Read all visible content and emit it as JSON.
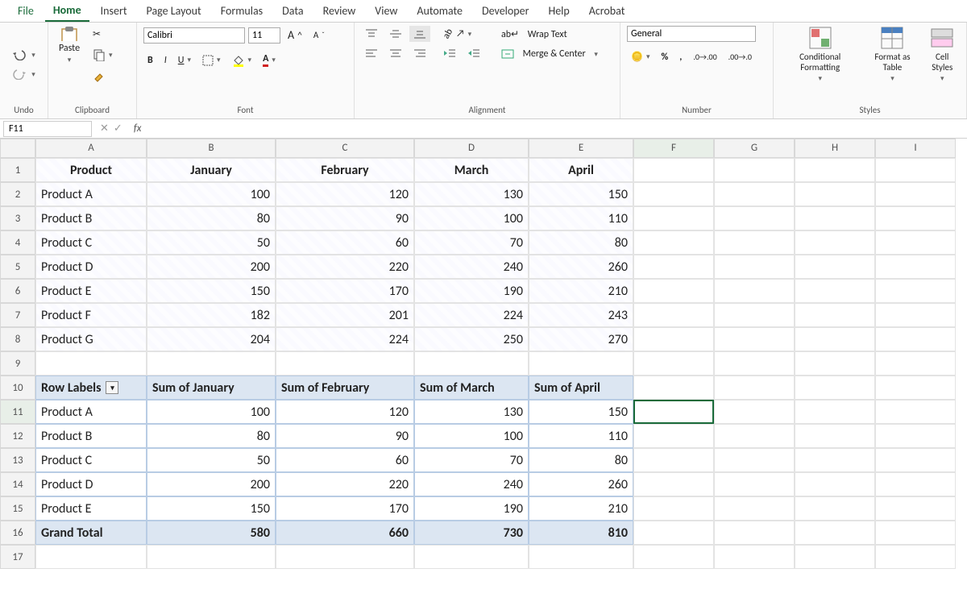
{
  "menu": {
    "items": [
      "File",
      "Home",
      "Insert",
      "Page Layout",
      "Formulas",
      "Data",
      "Review",
      "View",
      "Automate",
      "Developer",
      "Help",
      "Acrobat"
    ],
    "active": "Home"
  },
  "ribbon": {
    "groups": [
      "Undo",
      "Clipboard",
      "Font",
      "Alignment",
      "Number",
      "Styles"
    ],
    "clipboard": {
      "paste": "Paste"
    },
    "font": {
      "name": "Calibri",
      "size": "11"
    },
    "alignment": {
      "wrap": "Wrap Text",
      "merge": "Merge & Center"
    },
    "number": {
      "format": "General"
    },
    "styles": {
      "cond": "Conditional Formatting",
      "fat": "Format as Table",
      "cell": "Cell Styles"
    }
  },
  "namebox": "F11",
  "columns": [
    "A",
    "B",
    "C",
    "D",
    "E",
    "F",
    "G",
    "H",
    "I"
  ],
  "table": {
    "headers": [
      "Product",
      "January",
      "February",
      "March",
      "April"
    ],
    "rows": [
      [
        "Product A",
        100,
        120,
        130,
        150
      ],
      [
        "Product B",
        80,
        90,
        100,
        110
      ],
      [
        "Product C",
        50,
        60,
        70,
        80
      ],
      [
        "Product D",
        200,
        220,
        240,
        260
      ],
      [
        "Product E",
        150,
        170,
        190,
        210
      ],
      [
        "Product F",
        182,
        201,
        224,
        243
      ],
      [
        "Product G",
        204,
        224,
        250,
        270
      ]
    ]
  },
  "pivot": {
    "headers": [
      "Row Labels",
      "Sum of January",
      "Sum of February",
      "Sum of March",
      "Sum of April"
    ],
    "rows": [
      [
        "Product A",
        100,
        120,
        130,
        150
      ],
      [
        "Product B",
        80,
        90,
        100,
        110
      ],
      [
        "Product C",
        50,
        60,
        70,
        80
      ],
      [
        "Product D",
        200,
        220,
        240,
        260
      ],
      [
        "Product E",
        150,
        170,
        190,
        210
      ]
    ],
    "grand": [
      "Grand Total",
      580,
      660,
      730,
      810
    ]
  },
  "rownums": [
    1,
    2,
    3,
    4,
    5,
    6,
    7,
    8,
    9,
    10,
    11,
    12,
    13,
    14,
    15,
    16,
    17
  ],
  "selected": {
    "col": "F",
    "row": 11,
    "cell": "F11"
  }
}
